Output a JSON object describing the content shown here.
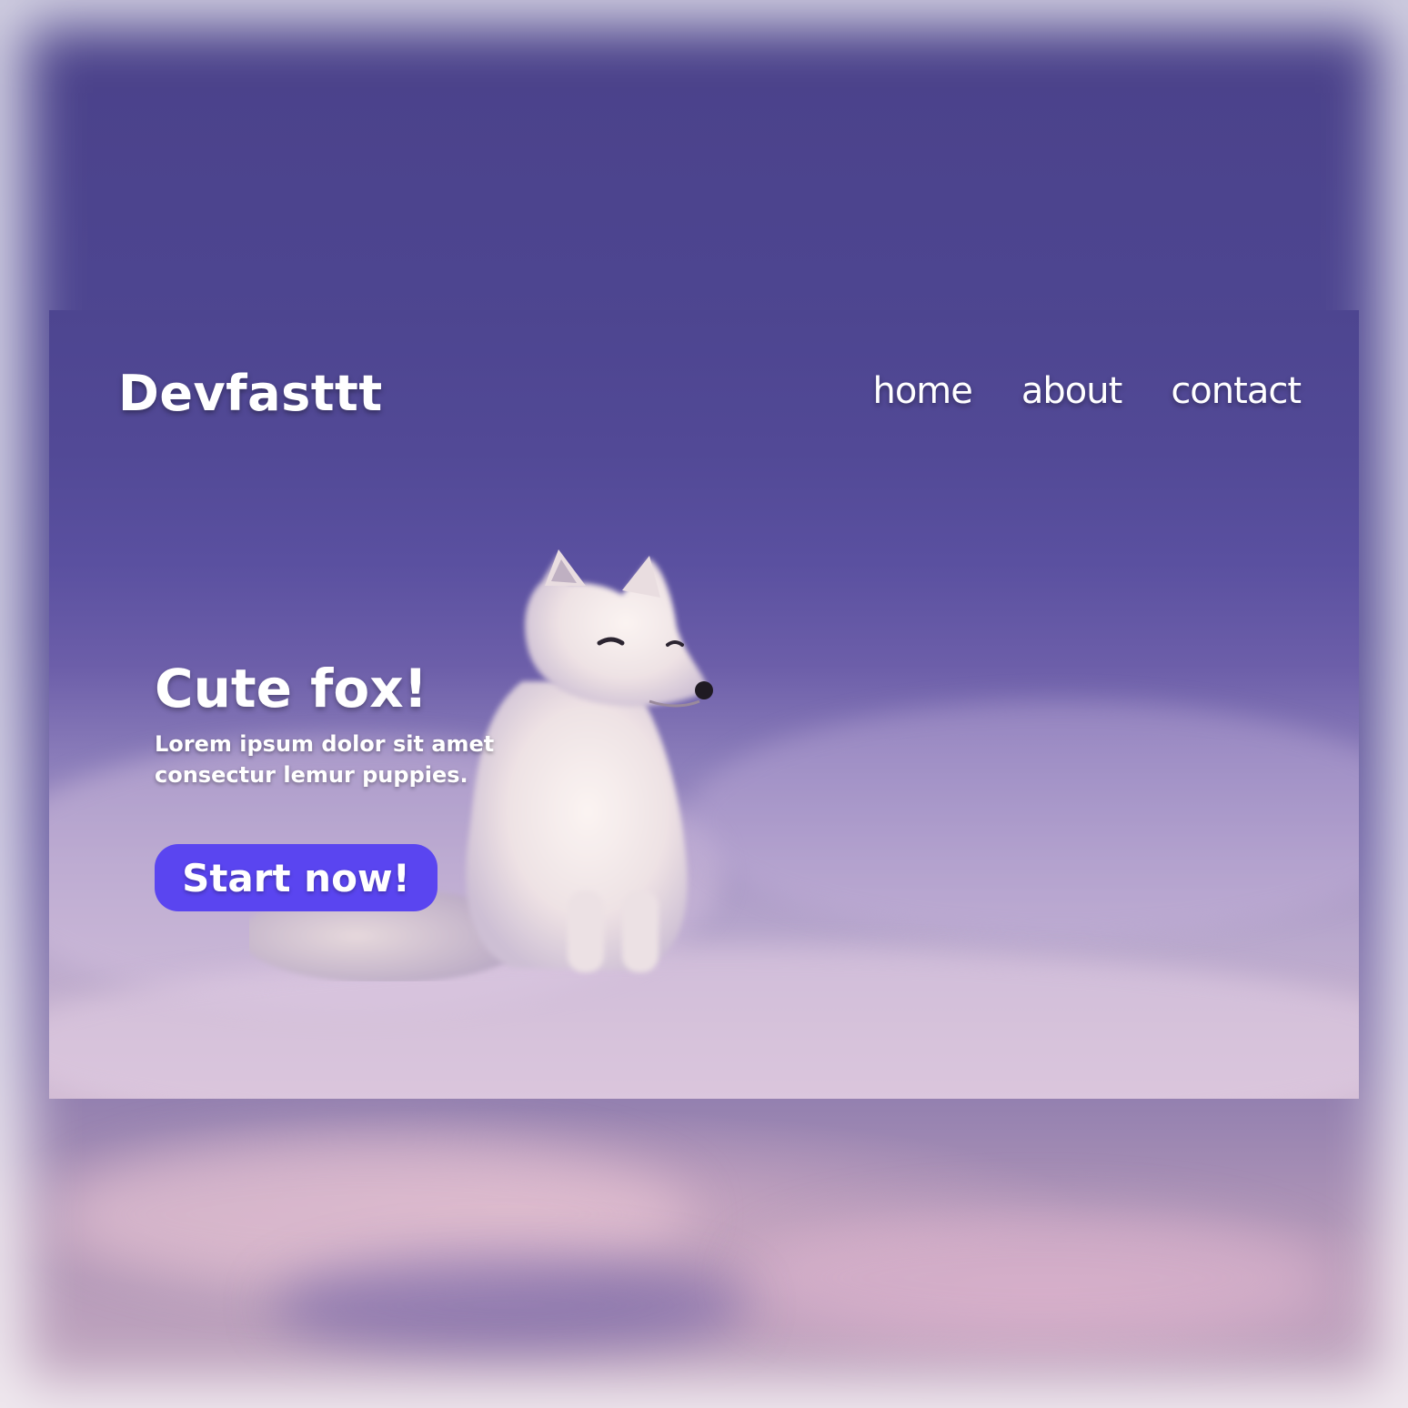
{
  "brand": {
    "name": "Devfasttt"
  },
  "nav": {
    "items": [
      {
        "label": "home"
      },
      {
        "label": "about"
      },
      {
        "label": "contact"
      }
    ]
  },
  "hero": {
    "title": "Cute fox!",
    "subtitle": "Lorem ipsum dolor sit amet\nconsectur lemur puppies.",
    "cta_label": "Start now!"
  },
  "icons": {
    "hero_image": "arctic-fox-photo"
  },
  "colors": {
    "accent": "#5a45f0",
    "overlay": "#4d4590",
    "text": "#ffffff"
  }
}
